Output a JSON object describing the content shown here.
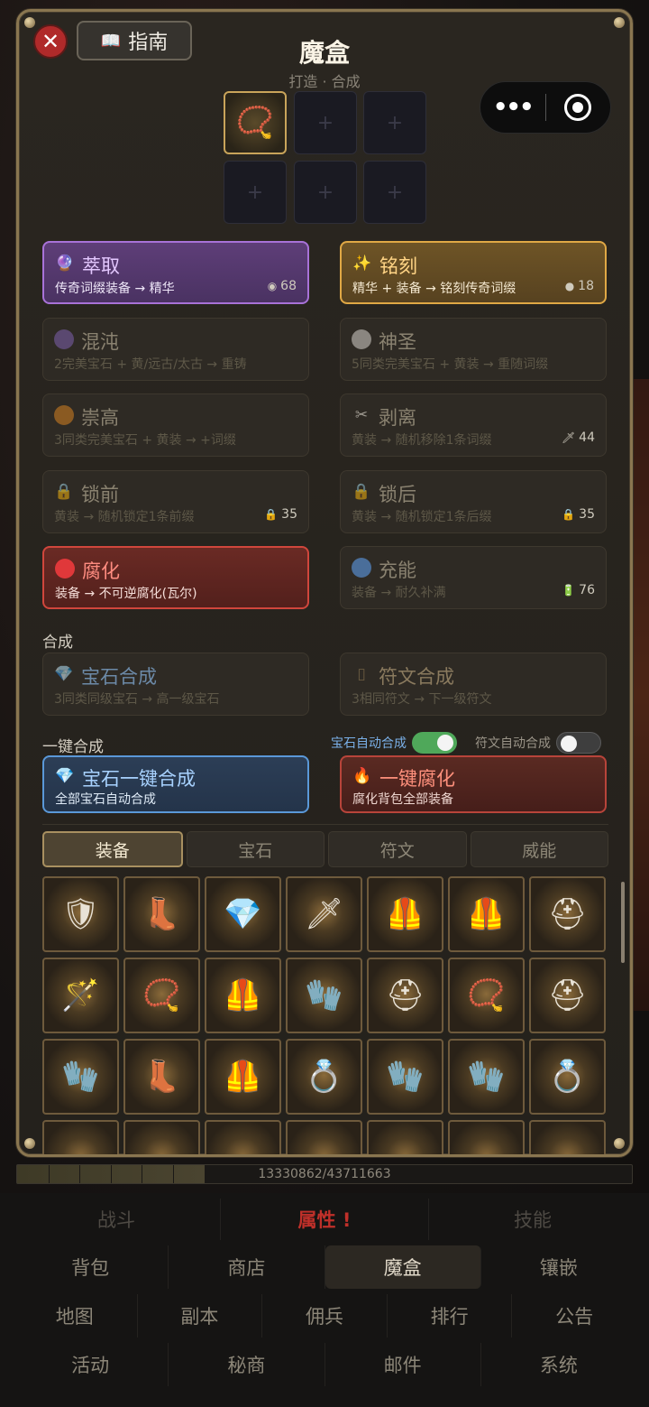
{
  "modal": {
    "title": "魔盒",
    "subtitle": "打造 · 合成",
    "guide_label": "指南",
    "close_icon": "✕",
    "empty_slot_glyph": "+"
  },
  "recipes": [
    {
      "id": "extract",
      "icon": "crystal-ball",
      "glyph": "🔮",
      "name": "萃取",
      "desc": "传奇词缀装备 → 精华",
      "cost": "68",
      "cost_icon": "essence-icon",
      "cost_glyph": "◉",
      "style": "purple"
    },
    {
      "id": "inscribe",
      "icon": "sparkle",
      "glyph": "✨",
      "name": "铭刻",
      "desc": "精华 + 装备 → 铭刻传奇词缀",
      "cost": "18",
      "cost_icon": "stone-icon",
      "cost_glyph": "●",
      "style": "gold"
    },
    {
      "id": "chaos",
      "icon": "purple-orb",
      "glyph": "",
      "name": "混沌",
      "desc": "2完美宝石 + 黄/远古/太古 → 重铸",
      "cost": "",
      "style": "dim",
      "dot": "#5a4870"
    },
    {
      "id": "holy",
      "icon": "white-orb",
      "glyph": "",
      "name": "神圣",
      "desc": "5同类完美宝石 + 黄装 → 重随词缀",
      "cost": "",
      "style": "dim",
      "dot": "#8a8680"
    },
    {
      "id": "exalt",
      "icon": "orange-orb",
      "glyph": "",
      "name": "崇高",
      "desc": "3同类完美宝石 + 黄装 → +词缀",
      "cost": "",
      "style": "dim",
      "dot": "#8a5a22"
    },
    {
      "id": "strip",
      "icon": "scissors",
      "glyph": "✂",
      "name": "剥离",
      "desc": "黄装 → 随机移除1条词缀",
      "cost": "44",
      "cost_icon": "dagger-icon",
      "cost_glyph": "🗡",
      "style": "dim"
    },
    {
      "id": "lock-prefix",
      "icon": "lock",
      "glyph": "🔒",
      "name": "锁前",
      "desc": "黄装 → 随机锁定1条前缀",
      "cost": "35",
      "cost_icon": "lock-icon",
      "cost_glyph": "🔒",
      "style": "dim"
    },
    {
      "id": "lock-suffix",
      "icon": "lock",
      "glyph": "🔒",
      "name": "锁后",
      "desc": "黄装 → 随机锁定1条后缀",
      "cost": "35",
      "cost_icon": "lock-icon",
      "cost_glyph": "🔒",
      "style": "dim"
    },
    {
      "id": "corrupt",
      "icon": "red-orb",
      "glyph": "",
      "name": "腐化",
      "desc": "装备 → 不可逆腐化(瓦尔)",
      "cost": "",
      "style": "red",
      "dot": "#e0383a"
    },
    {
      "id": "recharge",
      "icon": "blue-orb",
      "glyph": "",
      "name": "充能",
      "desc": "装备 → 耐久补满",
      "cost": "76",
      "cost_icon": "battery-icon",
      "cost_glyph": "🔋",
      "style": "dim",
      "dot": "#4a6e9a"
    }
  ],
  "synth": {
    "label": "合成",
    "gem": {
      "name": "宝石合成",
      "desc": "3同类同级宝石 → 高一级宝石",
      "glyph": "💎"
    },
    "rune": {
      "name": "符文合成",
      "desc": "3相同符文 → 下一级符文",
      "glyph": "▯"
    }
  },
  "oneclick": {
    "label": "一键合成",
    "gem_auto_label": "宝石自动合成",
    "gem_auto_on": true,
    "rune_auto_label": "符文自动合成",
    "rune_auto_on": false,
    "gem_btn": {
      "name": "宝石一键合成",
      "desc": "全部宝石自动合成",
      "glyph": "💎"
    },
    "corrupt_btn": {
      "name": "一键腐化",
      "desc": "腐化背包全部装备",
      "glyph": "🔥"
    }
  },
  "tabs": [
    "装备",
    "宝石",
    "符文",
    "威能"
  ],
  "active_tab": 0,
  "inventory": [
    [
      "shield",
      "boots",
      "gem",
      "sword",
      "chest",
      "chest",
      "helmet"
    ],
    [
      "staff",
      "amulet",
      "chest",
      "gloves",
      "helmet",
      "amulet",
      "helmet"
    ],
    [
      "gloves",
      "boots",
      "chest",
      "ring",
      "gloves",
      "gloves",
      "ring"
    ]
  ],
  "item_glyphs": {
    "shield": "🛡",
    "boots": "👢",
    "gem": "💎",
    "sword": "🗡",
    "chest": "🦺",
    "helmet": "⛑",
    "staff": "🪄",
    "amulet": "📿",
    "gloves": "🧤",
    "ring": "💍"
  },
  "xp": {
    "text": "13330862/43711663",
    "fraction": 0.305
  },
  "nav": {
    "row1": [
      {
        "label": "战斗",
        "state": "faded"
      },
      {
        "label": "属性 !",
        "state": "alert"
      },
      {
        "label": "技能",
        "state": "faded"
      }
    ],
    "row2": [
      {
        "label": "背包",
        "state": ""
      },
      {
        "label": "商店",
        "state": ""
      },
      {
        "label": "魔盒",
        "state": "active"
      },
      {
        "label": "镶嵌",
        "state": ""
      }
    ],
    "row3": [
      {
        "label": "地图",
        "state": ""
      },
      {
        "label": "副本",
        "state": ""
      },
      {
        "label": "佣兵",
        "state": ""
      },
      {
        "label": "排行",
        "state": ""
      },
      {
        "label": "公告",
        "state": ""
      }
    ],
    "row4": [
      {
        "label": "活动",
        "state": ""
      },
      {
        "label": "秘商",
        "state": ""
      },
      {
        "label": "邮件",
        "state": ""
      },
      {
        "label": "系统",
        "state": ""
      }
    ]
  },
  "colors": {
    "accent_gold": "#c9a45a",
    "purple": "#a872d8",
    "red": "#d0463c",
    "blue": "#5a98d8",
    "toggle_on": "#4fa85a"
  }
}
